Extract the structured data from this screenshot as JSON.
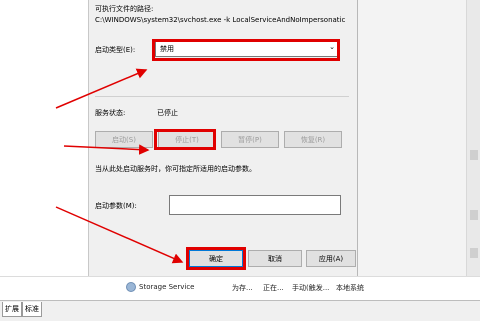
{
  "dialog": {
    "exe_path_label": "可执行文件的路径:",
    "exe_path_value": "C:\\WINDOWS\\system32\\svchost.exe -k LocalServiceAndNoImpersonatic",
    "startup_type_label": "启动类型(E):",
    "startup_type_value": "禁用",
    "service_status_label": "服务状态:",
    "service_status_value": "已停止",
    "buttons": {
      "start": "启动(S)",
      "stop": "停止(T)",
      "pause": "暂停(P)",
      "resume": "恢复(R)"
    },
    "hint": "当从此处启动服务时，你可指定所适用的启动参数。",
    "start_params_label": "启动参数(M):",
    "start_params_value": "",
    "ok": "确定",
    "cancel": "取消",
    "apply": "应用(A)"
  },
  "background": {
    "service_row": {
      "name": "Storage Service",
      "description": "为存...",
      "status": "正在...",
      "startup": "手动(触发...",
      "logon": "本地系统"
    },
    "tabs": [
      "扩展",
      "标准"
    ]
  },
  "colors": {
    "annotation": "#e00000",
    "dialog_bg": "#f0f0f0"
  }
}
